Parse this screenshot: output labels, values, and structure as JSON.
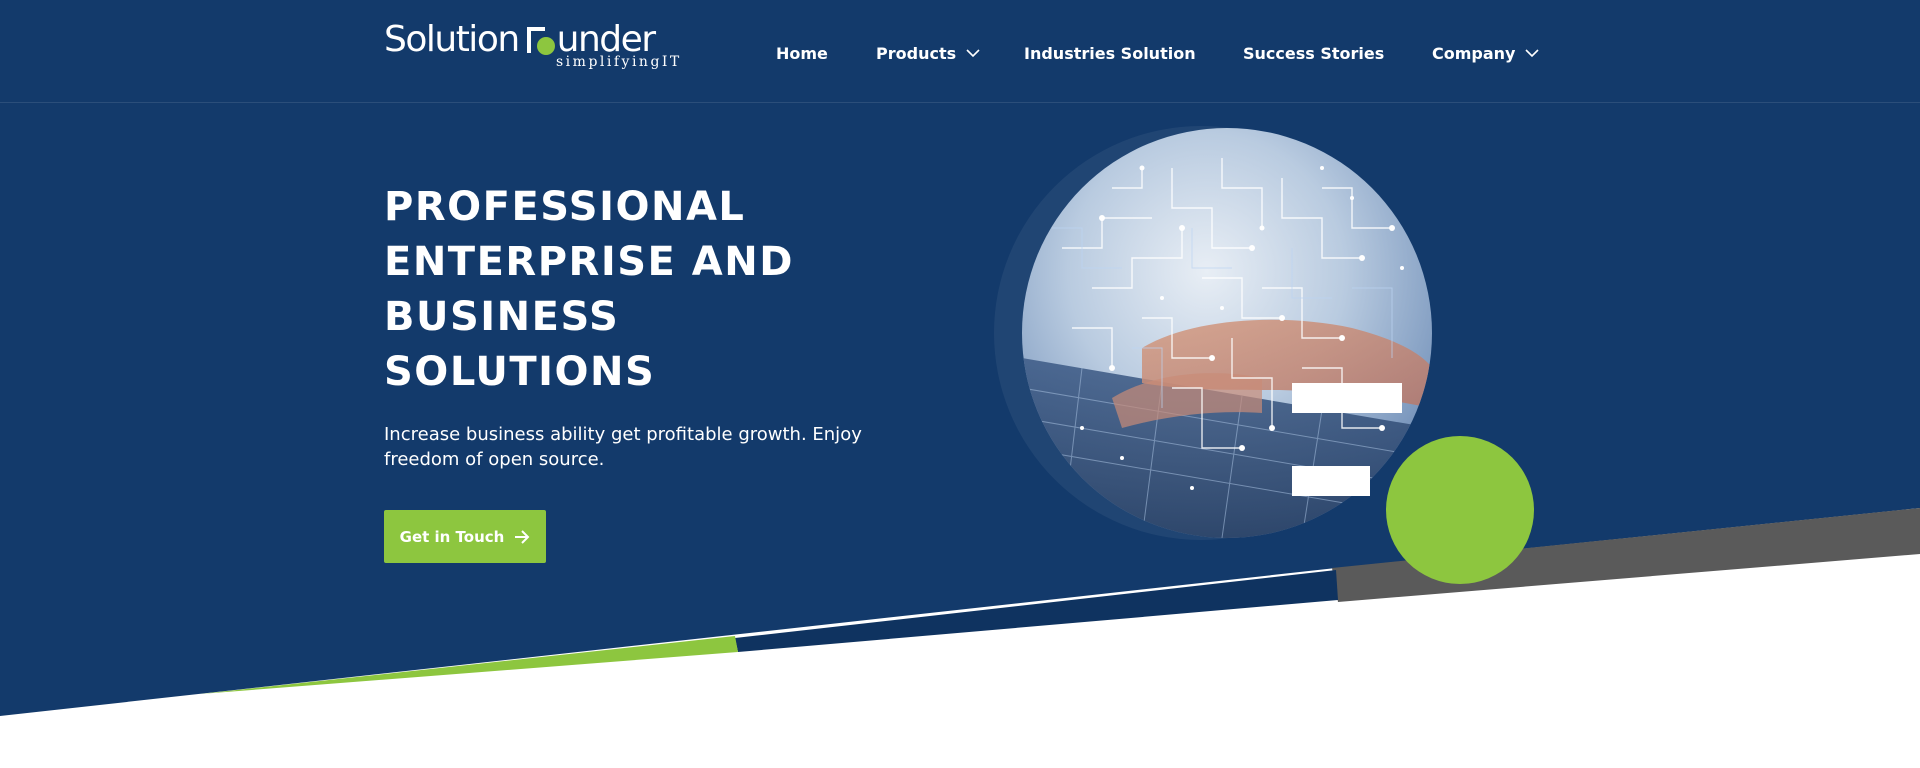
{
  "logo": {
    "name_part1": "Solution",
    "name_part2": "under",
    "tagline": "simplifyingIT"
  },
  "nav": {
    "items": [
      {
        "label": "Home",
        "has_dropdown": false
      },
      {
        "label": "Products",
        "has_dropdown": true
      },
      {
        "label": "Industries Solution",
        "has_dropdown": false
      },
      {
        "label": "Success Stories",
        "has_dropdown": false
      },
      {
        "label": "Company",
        "has_dropdown": true
      }
    ]
  },
  "hero": {
    "title_lines": [
      "PROFESSIONAL",
      "ENTERPRISE AND",
      "BUSINESS",
      "SOLUTIONS"
    ],
    "subtitle": "Increase business ability get profitable growth. Enjoy freedom of open source.",
    "cta_label": "Get in Touch",
    "cta_icon": "arrow-right-icon"
  },
  "colors": {
    "navy": "#133a6b",
    "navy_dark": "#0f3360",
    "accent_green": "#8dc63f",
    "band_gray": "#5a5a5a",
    "white": "#ffffff"
  }
}
